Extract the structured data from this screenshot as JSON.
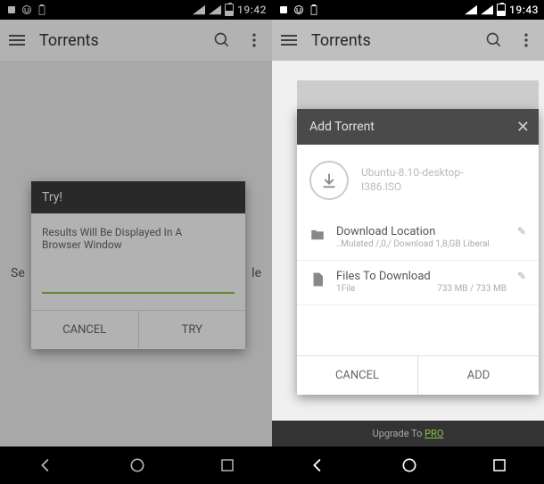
{
  "left": {
    "status": {
      "time": "19:42"
    },
    "app_title": "Torrents",
    "bg_text_left": "Se",
    "bg_text_right": "le",
    "dialog": {
      "title": "Try!",
      "body_line1": "Results Will Be Displayed In A",
      "body_line2": "Browser Window",
      "cancel": "CANCEL",
      "try": "TRY"
    }
  },
  "right": {
    "status": {
      "time": "19:43"
    },
    "app_title": "Torrents",
    "dialog": {
      "title": "Add Torrent",
      "torrent_name_line1": "Ubuntu-8.10-desktop-",
      "torrent_name_line2": "I386.ISO",
      "location_title": "Download Location",
      "location_sub": "..Mulated /,0,/ Download 1,8,GB Liberal",
      "files_title": "Files To Download",
      "files_sub": "1File",
      "files_size": "733 MB / 733 MB",
      "cancel": "CANCEL",
      "add": "ADD",
      "upgrade": "Upgrade To",
      "pro": "PRO"
    }
  }
}
